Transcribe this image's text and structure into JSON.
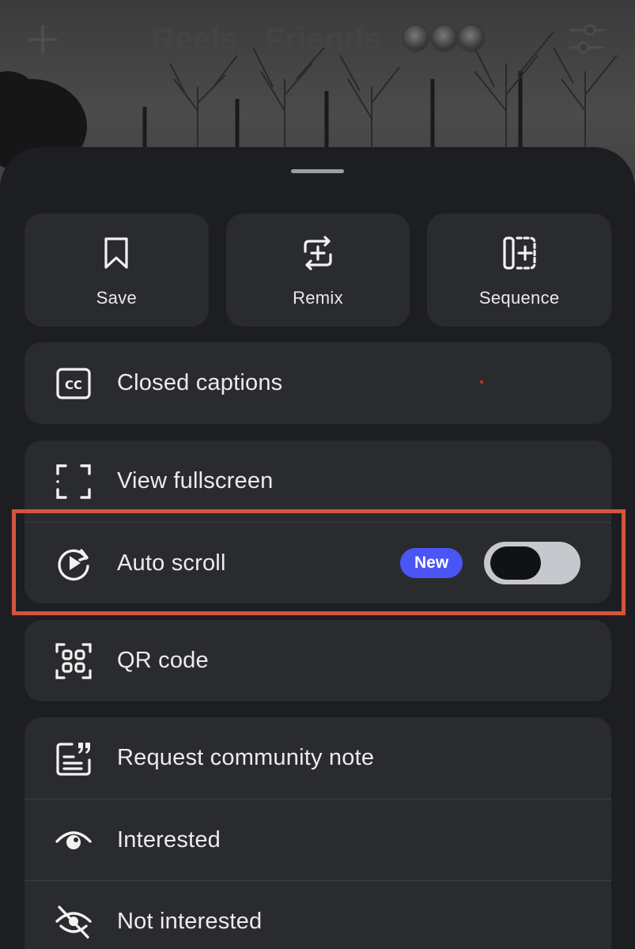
{
  "header": {
    "tabs": [
      "Reels",
      "Friends"
    ]
  },
  "top_actions": [
    {
      "label": "Save",
      "icon": "bookmark-icon"
    },
    {
      "label": "Remix",
      "icon": "remix-icon"
    },
    {
      "label": "Sequence",
      "icon": "sequence-icon"
    }
  ],
  "menu": {
    "closed_captions": {
      "label": "Closed captions",
      "icon": "cc-icon"
    },
    "view_fullscreen": {
      "label": "View fullscreen",
      "icon": "fullscreen-icon"
    },
    "auto_scroll": {
      "label": "Auto scroll",
      "icon": "auto-scroll-icon",
      "badge": "New",
      "toggle_on": false
    },
    "qr_code": {
      "label": "QR code",
      "icon": "qr-code-icon"
    },
    "request_community_note": {
      "label": "Request community note",
      "icon": "community-note-icon"
    },
    "interested": {
      "label": "Interested",
      "icon": "eye-icon"
    },
    "not_interested": {
      "label": "Not interested",
      "icon": "eye-slash-icon"
    }
  },
  "colors": {
    "sheet_bg": "#1d1e21",
    "card_bg": "#2a2b2e",
    "badge_bg": "#4b55f6",
    "highlight": "#d4543d",
    "toggle_track": "#c6c8ce"
  }
}
